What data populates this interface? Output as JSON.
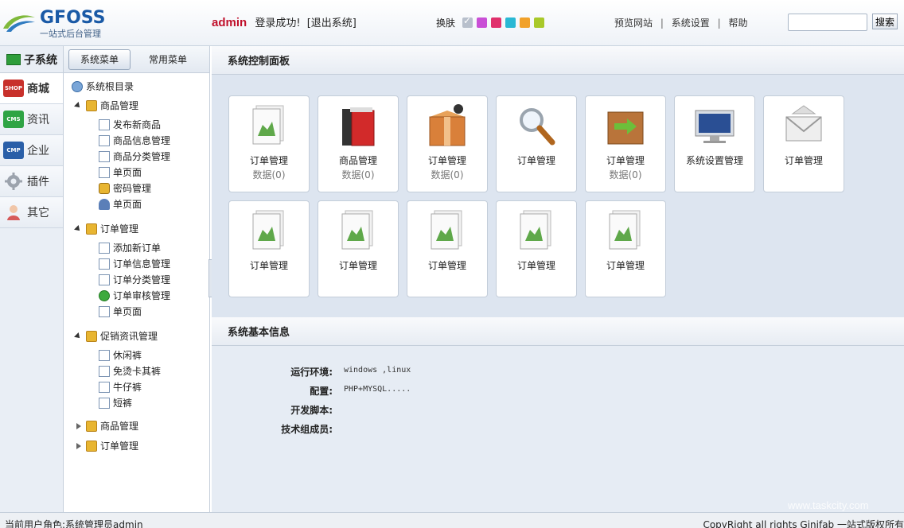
{
  "header": {
    "logo_title": "GFOSS",
    "logo_subtitle": "一站式后台管理",
    "user_name": "admin",
    "login_msg": "登录成功!",
    "logout_label": "[退出系统]",
    "skin_label": "换肤",
    "skin_colors": [
      "#b8c0cc",
      "#c94fd6",
      "#e0306c",
      "#2ab8d4",
      "#f1a12a",
      "#a9c92a"
    ],
    "links": [
      "预览网站",
      "系统设置",
      "帮助"
    ],
    "search_placeholder": "",
    "search_button": "搜索"
  },
  "rail": {
    "title": "子系统",
    "items": [
      {
        "label": "商城",
        "icon": "shop-icon",
        "icon_text": "SHOP",
        "color": "#c8312b",
        "active": true
      },
      {
        "label": "资讯",
        "icon": "cms-icon",
        "icon_text": "CMS",
        "color": "#2fa444",
        "active": false
      },
      {
        "label": "企业",
        "icon": "cmp-icon",
        "icon_text": "CMP",
        "color": "#2a5fa8",
        "active": false
      },
      {
        "label": "插件",
        "icon": "gear-icon",
        "icon_text": "",
        "color": "#8a8f98",
        "active": false
      },
      {
        "label": "其它",
        "icon": "user-icon",
        "icon_text": "",
        "color": "#d66b6b",
        "active": false
      }
    ]
  },
  "tree_tabs": [
    "系统菜单",
    "常用菜单"
  ],
  "tree": {
    "root": "系统根目录",
    "groups": [
      {
        "label": "商品管理",
        "open": true,
        "items": [
          "发布新商品",
          "商品信息管理",
          "商品分类管理",
          "单页面",
          "密码管理",
          "单页面"
        ]
      },
      {
        "label": "订单管理",
        "open": true,
        "items": [
          "添加新订单",
          "订单信息管理",
          "订单分类管理",
          "订单审核管理",
          "单页面"
        ]
      },
      {
        "label": "促销资讯管理",
        "open": true,
        "items": [
          "休闲裤",
          "免烫卡其裤",
          "牛仔裤",
          "短裤"
        ]
      },
      {
        "label": "商品管理",
        "open": false,
        "items": []
      },
      {
        "label": "订单管理",
        "open": false,
        "items": []
      }
    ]
  },
  "dashboard": {
    "title": "系统控制面板",
    "tiles": [
      {
        "title": "订单管理",
        "sub": "数据(0)",
        "icon": "document-chart-icon"
      },
      {
        "title": "商品管理",
        "sub": "数据(0)",
        "icon": "books-icon"
      },
      {
        "title": "订单管理",
        "sub": "数据(0)",
        "icon": "box-icon"
      },
      {
        "title": "订单管理",
        "sub": "",
        "icon": "magnifier-icon"
      },
      {
        "title": "订单管理",
        "sub": "数据(0)",
        "icon": "package-arrows-icon"
      },
      {
        "title": "系统设置管理",
        "sub": "",
        "icon": "monitor-icon"
      },
      {
        "title": "订单管理",
        "sub": "",
        "icon": "envelope-icon"
      },
      {
        "title": "订单管理",
        "sub": "",
        "icon": "document-chart-icon"
      },
      {
        "title": "订单管理",
        "sub": "",
        "icon": "document-chart-icon"
      },
      {
        "title": "订单管理",
        "sub": "",
        "icon": "document-chart-icon"
      },
      {
        "title": "订单管理",
        "sub": "",
        "icon": "document-chart-icon"
      },
      {
        "title": "订单管理",
        "sub": "",
        "icon": "document-chart-icon"
      }
    ]
  },
  "info": {
    "title": "系统基本信息",
    "rows": [
      {
        "key": "运行环境:",
        "value": "windows ,linux"
      },
      {
        "key": "配置:",
        "value": "PHP+MYSQL....."
      },
      {
        "key": "开发脚本:",
        "value": ""
      },
      {
        "key": "技术组成员:",
        "value": ""
      }
    ]
  },
  "watermark": "www.taskcity.com",
  "status": {
    "left": "当前用户角色:系统管理员admin",
    "right": "CopyRight all rights Ginifab 一站式版权所有"
  }
}
